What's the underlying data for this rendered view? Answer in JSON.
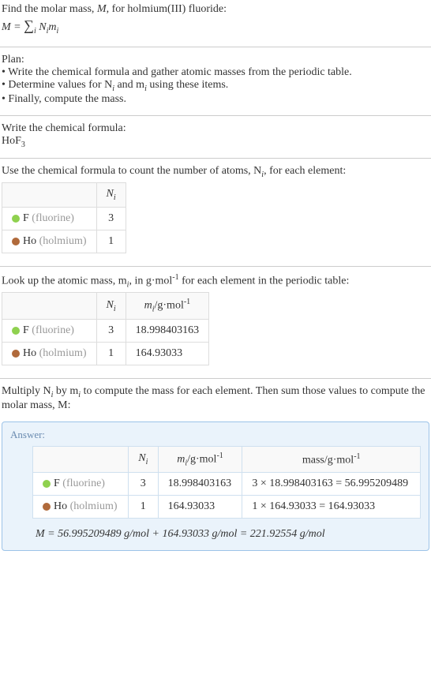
{
  "intro": {
    "line1": "Find the molar mass, M, for holmium(III) fluoride:",
    "formula_lhs": "M = ",
    "formula_sum": "∑",
    "formula_sub": "i",
    "formula_rhs": " N",
    "formula_i1": "i",
    "formula_m": "m",
    "formula_i2": "i"
  },
  "plan": {
    "title": "Plan:",
    "b1": "• Write the chemical formula and gather atomic masses from the periodic table.",
    "b2_a": "• Determine values for N",
    "b2_b": " and m",
    "b2_c": " using these items.",
    "b3": "• Finally, compute the mass."
  },
  "chemformula": {
    "title": "Write the chemical formula:",
    "f_main": "HoF",
    "f_sub": "3"
  },
  "count": {
    "title_a": "Use the chemical formula to count the number of atoms, N",
    "title_b": ", for each element:",
    "h_ni": "N",
    "r1_sym": "F",
    "r1_name": "(fluorine)",
    "r1_n": "3",
    "r2_sym": "Ho",
    "r2_name": "(holmium)",
    "r2_n": "1"
  },
  "lookup": {
    "title_a": "Look up the atomic mass, m",
    "title_b": ", in g·mol",
    "title_c": " for each element in the periodic table:",
    "h_ni": "N",
    "h_mi": "m",
    "h_unit": "/g·mol",
    "r1_sym": "F",
    "r1_name": "(fluorine)",
    "r1_n": "3",
    "r1_m": "18.998403163",
    "r2_sym": "Ho",
    "r2_name": "(holmium)",
    "r2_n": "1",
    "r2_m": "164.93033"
  },
  "multiply": {
    "line_a": "Multiply N",
    "line_b": " by m",
    "line_c": " to compute the mass for each element. Then sum those values to compute the molar mass, M:"
  },
  "answer": {
    "title": "Answer:",
    "h_ni": "N",
    "h_mi": "m",
    "h_unit": "/g·mol",
    "h_mass": "mass/g·mol",
    "r1_sym": "F",
    "r1_name": "(fluorine)",
    "r1_n": "3",
    "r1_m": "18.998403163",
    "r1_mass": "3 × 18.998403163 = 56.995209489",
    "r2_sym": "Ho",
    "r2_name": "(holmium)",
    "r2_n": "1",
    "r2_m": "164.93033",
    "r2_mass": "1 × 164.93033 = 164.93033",
    "final": "M = 56.995209489 g/mol + 164.93033 g/mol = 221.92554 g/mol"
  },
  "sub_i": "i",
  "sup_neg1": "-1"
}
